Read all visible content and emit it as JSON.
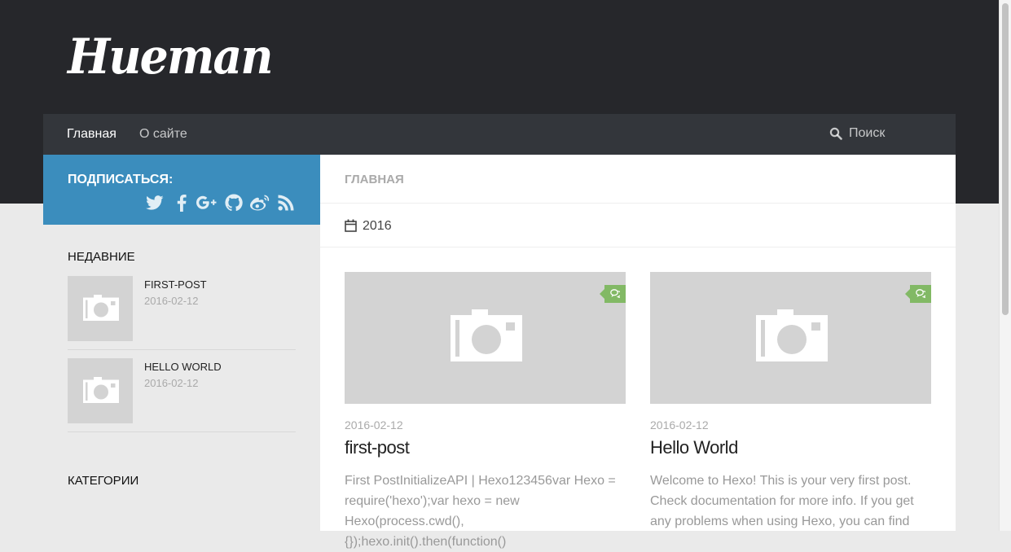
{
  "site": {
    "logo": "Hueman"
  },
  "nav": {
    "items": [
      {
        "label": "Главная",
        "active": true
      },
      {
        "label": "О сайте",
        "active": false
      }
    ],
    "search_label": "Поиск"
  },
  "sidebar": {
    "follow_title": "ПОДПИСАТЬСЯ:",
    "social_icons": [
      "twitter-icon",
      "facebook-icon",
      "google-plus-icon",
      "github-icon",
      "weibo-icon",
      "rss-icon"
    ],
    "recent_title": "НЕДАВНИЕ",
    "recent_posts": [
      {
        "title": "FIRST-POST",
        "date": "2016-02-12"
      },
      {
        "title": "HELLO WORLD",
        "date": "2016-02-12"
      }
    ],
    "categories_title": "КАТЕГОРИИ"
  },
  "main": {
    "page_title": "ГЛАВНАЯ",
    "archive_year": "2016",
    "posts": [
      {
        "date": "2016-02-12",
        "title": "first-post",
        "excerpt": "First PostInitializeAPI | Hexo123456var Hexo = require('hexo');var hexo = new Hexo(process.cwd(), {});hexo.init().then(function()"
      },
      {
        "date": "2016-02-12",
        "title": "Hello World",
        "excerpt": "Welcome to Hexo! This is your very first post. Check documentation for more info. If you get any problems when using Hexo, you can find"
      }
    ]
  },
  "colors": {
    "header_bg": "#26272b",
    "nav_bg": "#33363b",
    "follow_bg": "#3b8dbd",
    "comment_badge": "#82b965",
    "page_bg": "#eaeaea"
  }
}
